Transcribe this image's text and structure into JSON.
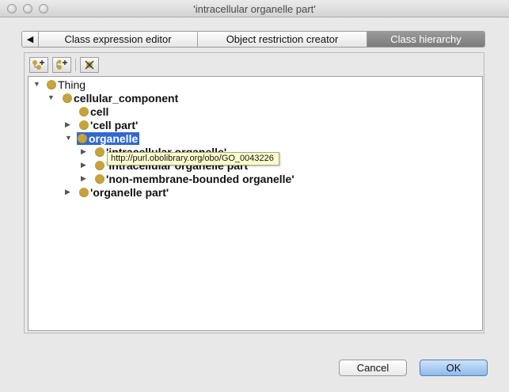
{
  "window": {
    "title": "'intracellular organelle part'"
  },
  "tabs": [
    {
      "label": "Class expression editor",
      "active": false
    },
    {
      "label": "Object restriction creator",
      "active": false
    },
    {
      "label": "Class hierarchy",
      "active": true
    }
  ],
  "toolbar": {
    "icons": [
      "add-subclass-icon",
      "add-sibling-class-icon",
      "delete-class-icon"
    ]
  },
  "tree": {
    "nodes": [
      {
        "label": "Thing",
        "expander": "expanded"
      },
      {
        "label": "cellular_component",
        "expander": "expanded"
      },
      {
        "label": "cell",
        "expander": "none"
      },
      {
        "label": "'cell part'",
        "expander": "collapsed"
      },
      {
        "label": "organelle",
        "expander": "expanded",
        "selected": true
      },
      {
        "label": "'intracellular organelle'",
        "expander": "collapsed"
      },
      {
        "label": "'intracellular organelle part'",
        "expander": "collapsed"
      },
      {
        "label": "'non-membrane-bounded organelle'",
        "expander": "collapsed"
      },
      {
        "label": "'organelle part'",
        "expander": "collapsed"
      }
    ],
    "class_icon_color": "#c7a33b",
    "selection_color": "#3168d2"
  },
  "tooltip": {
    "text": "http://purl.obolibrary.org/obo/GO_0043226"
  },
  "buttons": {
    "cancel": "Cancel",
    "ok": "OK"
  }
}
